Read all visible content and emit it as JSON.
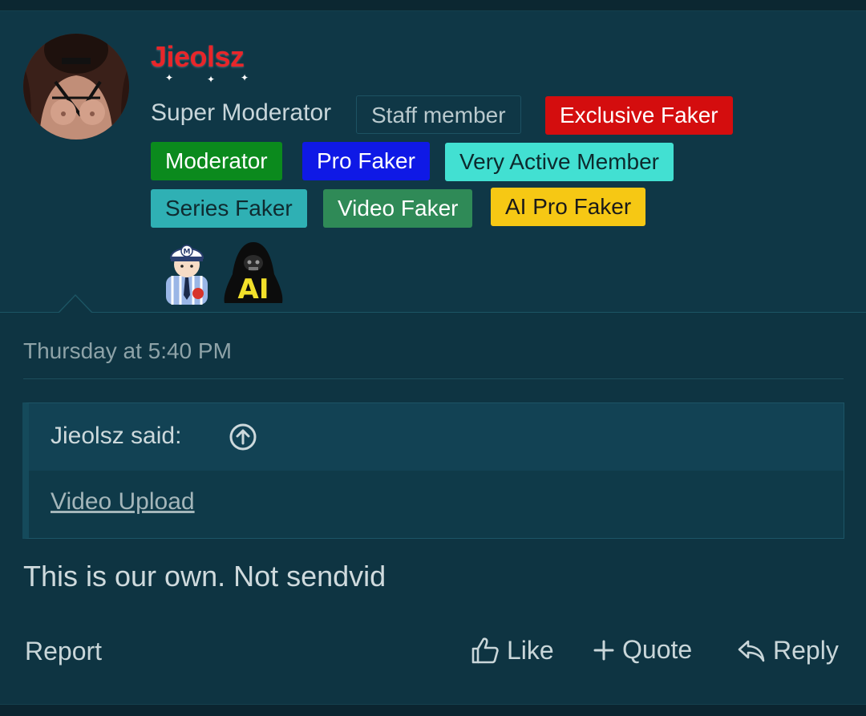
{
  "user": {
    "name": "Jieolsz",
    "title": "Super Moderator",
    "name_color": "#e8262a"
  },
  "badges": [
    {
      "label": "Staff member",
      "color": "transparent"
    },
    {
      "label": "Exclusive Faker",
      "color": "#d40d0e"
    },
    {
      "label": "Moderator",
      "color": "#0b8a1d"
    },
    {
      "label": "Pro Faker",
      "color": "#0f19e6"
    },
    {
      "label": "Very Active Member",
      "color": "#42e0d2"
    },
    {
      "label": "Series Faker",
      "color": "#2fb0b4"
    },
    {
      "label": "Video Faker",
      "color": "#2f8a57"
    },
    {
      "label": "AI Pro Faker",
      "color": "#f6c814"
    }
  ],
  "trophies": [
    {
      "icon": "moderator-trophy-icon",
      "letter": "M"
    },
    {
      "icon": "ai-hooded-trophy-icon",
      "letter": "AI"
    }
  ],
  "post": {
    "timestamp": "Thursday at 5:40 PM",
    "quote": {
      "author_line": "Jieolsz said:",
      "link_text": "Video Upload"
    },
    "body": "This is our own. Not sendvid"
  },
  "actions": {
    "report": "Report",
    "like": "Like",
    "quote": "Quote",
    "reply": "Reply"
  }
}
